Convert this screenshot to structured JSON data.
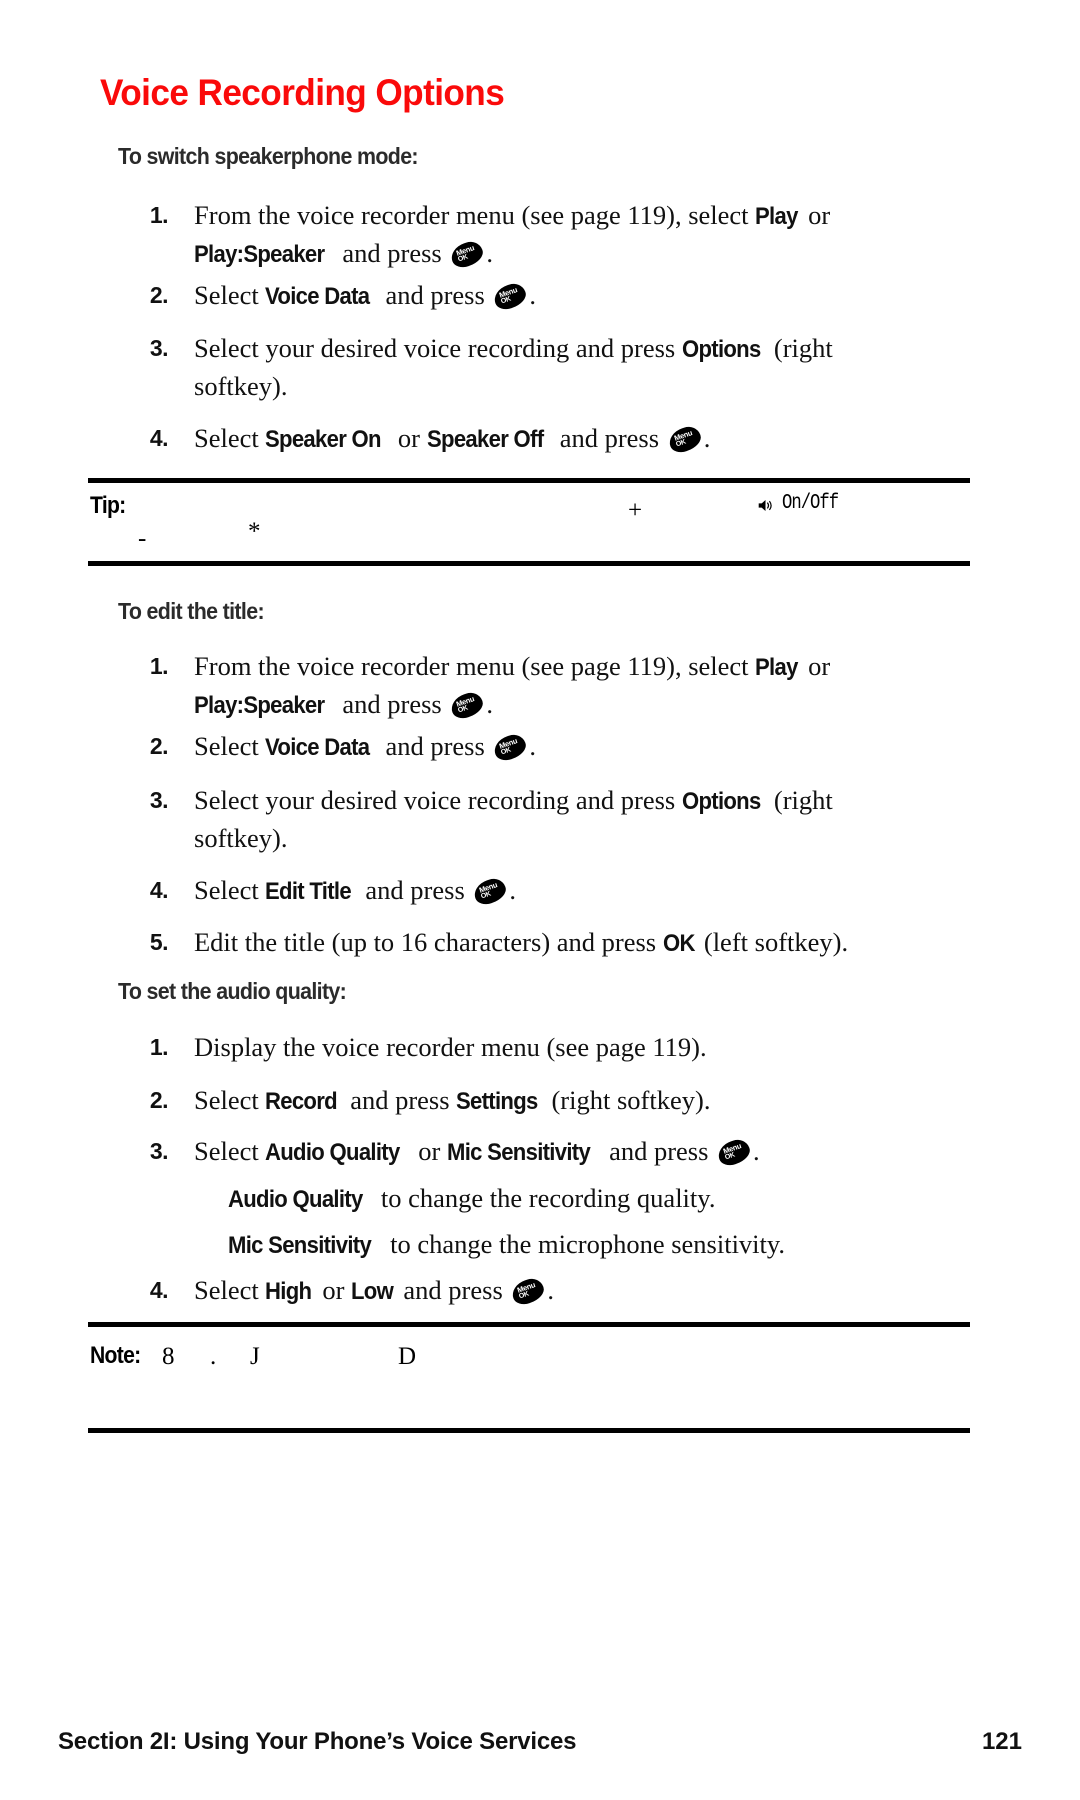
{
  "page": {
    "title": "Voice Recording Options",
    "title_color": "#fa0a0a",
    "number": "121",
    "footer_section": "Section 2I: Using Your Phone’s Voice Services"
  },
  "icons": {
    "menu_ok": {
      "name": "menu-ok-key-icon",
      "line1": "Menu",
      "line2": "OK"
    },
    "speaker": {
      "name": "speaker-icon"
    }
  },
  "sections": [
    {
      "heading": "To switch speakerphone mode:",
      "steps": [
        {
          "num": "1.",
          "pre": "From the voice recorder menu (see page 119), select ",
          "kw1": "Play",
          "mid": " or ",
          "kw2": "Play:Speaker",
          "post": " and press ",
          "tail": "."
        },
        {
          "num": "2.",
          "pre": "Select ",
          "kw1": "Voice Data",
          "post": " and press ",
          "tail": "."
        },
        {
          "num": "3.",
          "pre": "Select your desired voice recording and press ",
          "kw1": "Options",
          "post": " (right softkey)."
        },
        {
          "num": "4.",
          "pre": "Select ",
          "kw1": "Speaker On",
          "mid": " or ",
          "kw2": "Speaker Off",
          "post": " and press ",
          "tail": "."
        }
      ]
    },
    {
      "heading": "To edit the title:",
      "steps": [
        {
          "num": "1.",
          "pre": "From the voice recorder menu (see page 119), select ",
          "kw1": "Play",
          "mid": " or ",
          "kw2": "Play:Speaker",
          "post": " and press ",
          "tail": "."
        },
        {
          "num": "2.",
          "pre": "Select ",
          "kw1": "Voice Data",
          "post": " and press ",
          "tail": "."
        },
        {
          "num": "3.",
          "pre": "Select your desired voice recording and press ",
          "kw1": "Options",
          "post": " (right softkey)."
        },
        {
          "num": "4.",
          "pre": "Select ",
          "kw1": "Edit Title",
          "post": " and press ",
          "tail": "."
        },
        {
          "num": "5.",
          "pre": "Edit the title (up to 16 characters) and press ",
          "kw1": "OK",
          "post": " (left softkey)."
        }
      ]
    },
    {
      "heading": "To set the audio quality:",
      "steps": [
        {
          "num": "1.",
          "pre": "Display the voice recorder menu (see page 119)."
        },
        {
          "num": "2.",
          "pre": "Select ",
          "kw1": "Record",
          "mid": " and press ",
          "kw2": "Settings",
          "post": " (right softkey)."
        },
        {
          "num": "3.",
          "pre": "Select ",
          "kw1": "Audio Quality",
          "mid": " or ",
          "kw2": "Mic Sensitivity",
          "post": " and press ",
          "tail": "."
        }
      ],
      "bullets": [
        {
          "kw": "Audio Quality",
          "text": " to change the recording quality."
        },
        {
          "kw": "Mic Sensitivity",
          "text": " to change the microphone sensitivity."
        }
      ],
      "steps_after": [
        {
          "num": "4.",
          "pre": "Select ",
          "kw1": "High",
          "mid": " or ",
          "kw2": "Low",
          "post": " and press ",
          "tail": "."
        }
      ]
    }
  ],
  "tip_box": {
    "label": "Tip:",
    "plus": "+",
    "onoff_label": "On/Off",
    "line2_a": "-",
    "line2_b": "*"
  },
  "note_box": {
    "label": "Note:",
    "c1": "8",
    "c2": ".",
    "c3": "J",
    "c4": "D"
  }
}
